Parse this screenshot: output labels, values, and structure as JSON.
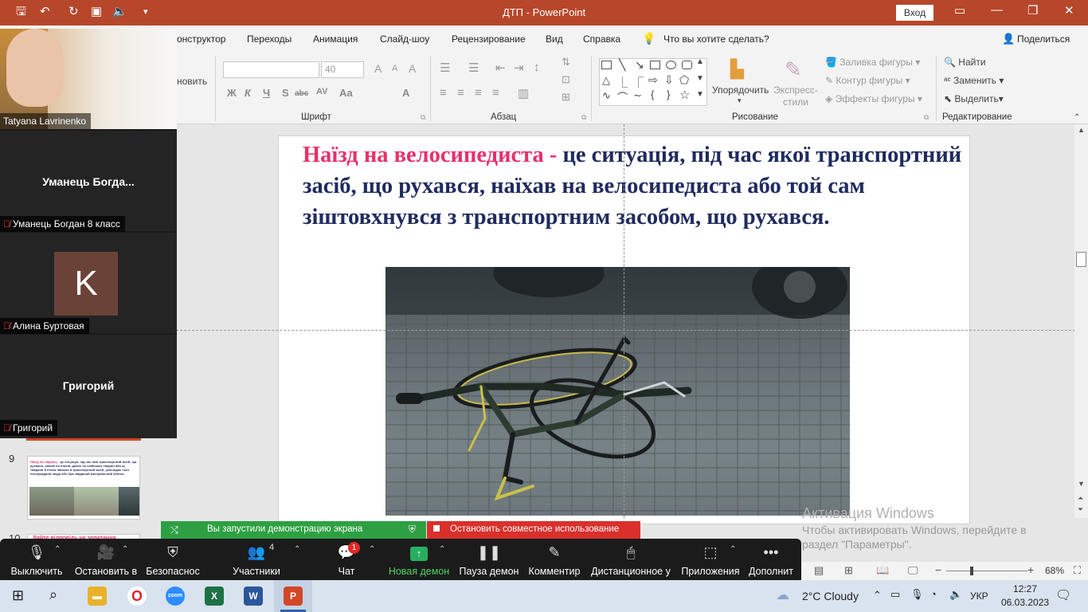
{
  "window": {
    "title": "ДТП  -  PowerPoint",
    "login": "Вход"
  },
  "tabs": [
    "онструктор",
    "Переходы",
    "Анимация",
    "Слайд-шоу",
    "Рецензирование",
    "Вид",
    "Справка",
    "Что вы хотите сделать?"
  ],
  "share_label": "Поделиться",
  "ribbon": {
    "clipboard_partial": "новить",
    "font_group": "Шрифт",
    "font_size": "40",
    "paragraph_group": "Абзац",
    "drawing_group": "Рисование",
    "arrange": "Упорядочить",
    "express_styles": "Экспресс-стили",
    "fill": "Заливка фигуры",
    "outline": "Контур фигуры",
    "effects": "Эффекты фигуры",
    "editing_group": "Редактирование",
    "find": "Найти",
    "replace": "Заменить",
    "select": "Выделить",
    "format_buttons": [
      "Ж",
      "К",
      "Ч",
      "S",
      "abc",
      "AV",
      "Aa",
      "A"
    ]
  },
  "slide": {
    "red_text": "Наїзд на велосипедиста - ",
    "body_text": "це ситуація, під час якої транспортний засіб, що рухався, наїхав на велосипедиста або той сам зіштовхнувся з транспортним засобом, що рухався."
  },
  "thumbnails": {
    "slide9_number": "9",
    "slide9_title": "Наїзд на тварину",
    "slide9_text": " - це ситуація, під час якої транспортний засіб, що рухався, наїхав на птахів, диких чи свійських тварин або ці тварини й птахи наїхали в транспортний засіб, унаслідок чого постраждали люди або був завданий матеріальний збиток.",
    "slide10_number": "10",
    "slide10_text": "Дайте відповідь на запитання"
  },
  "participants": [
    {
      "label": "Tatyana Lavrinenko"
    },
    {
      "name": "Уманець  Богда...",
      "label": "Уманець Богдан 8 класс"
    },
    {
      "initial": "K",
      "label": "Алина Буртовая"
    },
    {
      "name": "Григорий",
      "label": "Григорий"
    }
  ],
  "share": {
    "banner": "Вы запустили демонстрацию экрана",
    "stop": "Остановить совместное использование"
  },
  "zoom_toolbar": [
    {
      "label": "Выключить",
      "icon": "mic-icon"
    },
    {
      "label": "Остановить в",
      "icon": "video-icon"
    },
    {
      "label": "Безопаснос",
      "icon": "shield-icon"
    },
    {
      "label": "Участники",
      "icon": "participants-icon",
      "count": "4"
    },
    {
      "label": "Чат",
      "icon": "chat-icon",
      "badge": "1"
    },
    {
      "label": "Новая демон",
      "icon": "share-icon"
    },
    {
      "label": "Пауза демон",
      "icon": "pause-icon"
    },
    {
      "label": "Комментир",
      "icon": "annotate-icon"
    },
    {
      "label": "Дистанционное у",
      "icon": "remote-control-icon"
    },
    {
      "label": "Приложения",
      "icon": "apps-icon"
    },
    {
      "label": "Дополнит",
      "icon": "more-icon"
    }
  ],
  "activation": {
    "title": "Активация Windows",
    "line1": "Чтобы активировать Windows, перейдите в",
    "line2": "раздел \"Параметры\"."
  },
  "statusbar": {
    "zoom": "68%"
  },
  "taskbar": {
    "weather": "2°C  Cloudy",
    "lang": "УКР",
    "time": "12:27",
    "date": "06.03.2023"
  }
}
